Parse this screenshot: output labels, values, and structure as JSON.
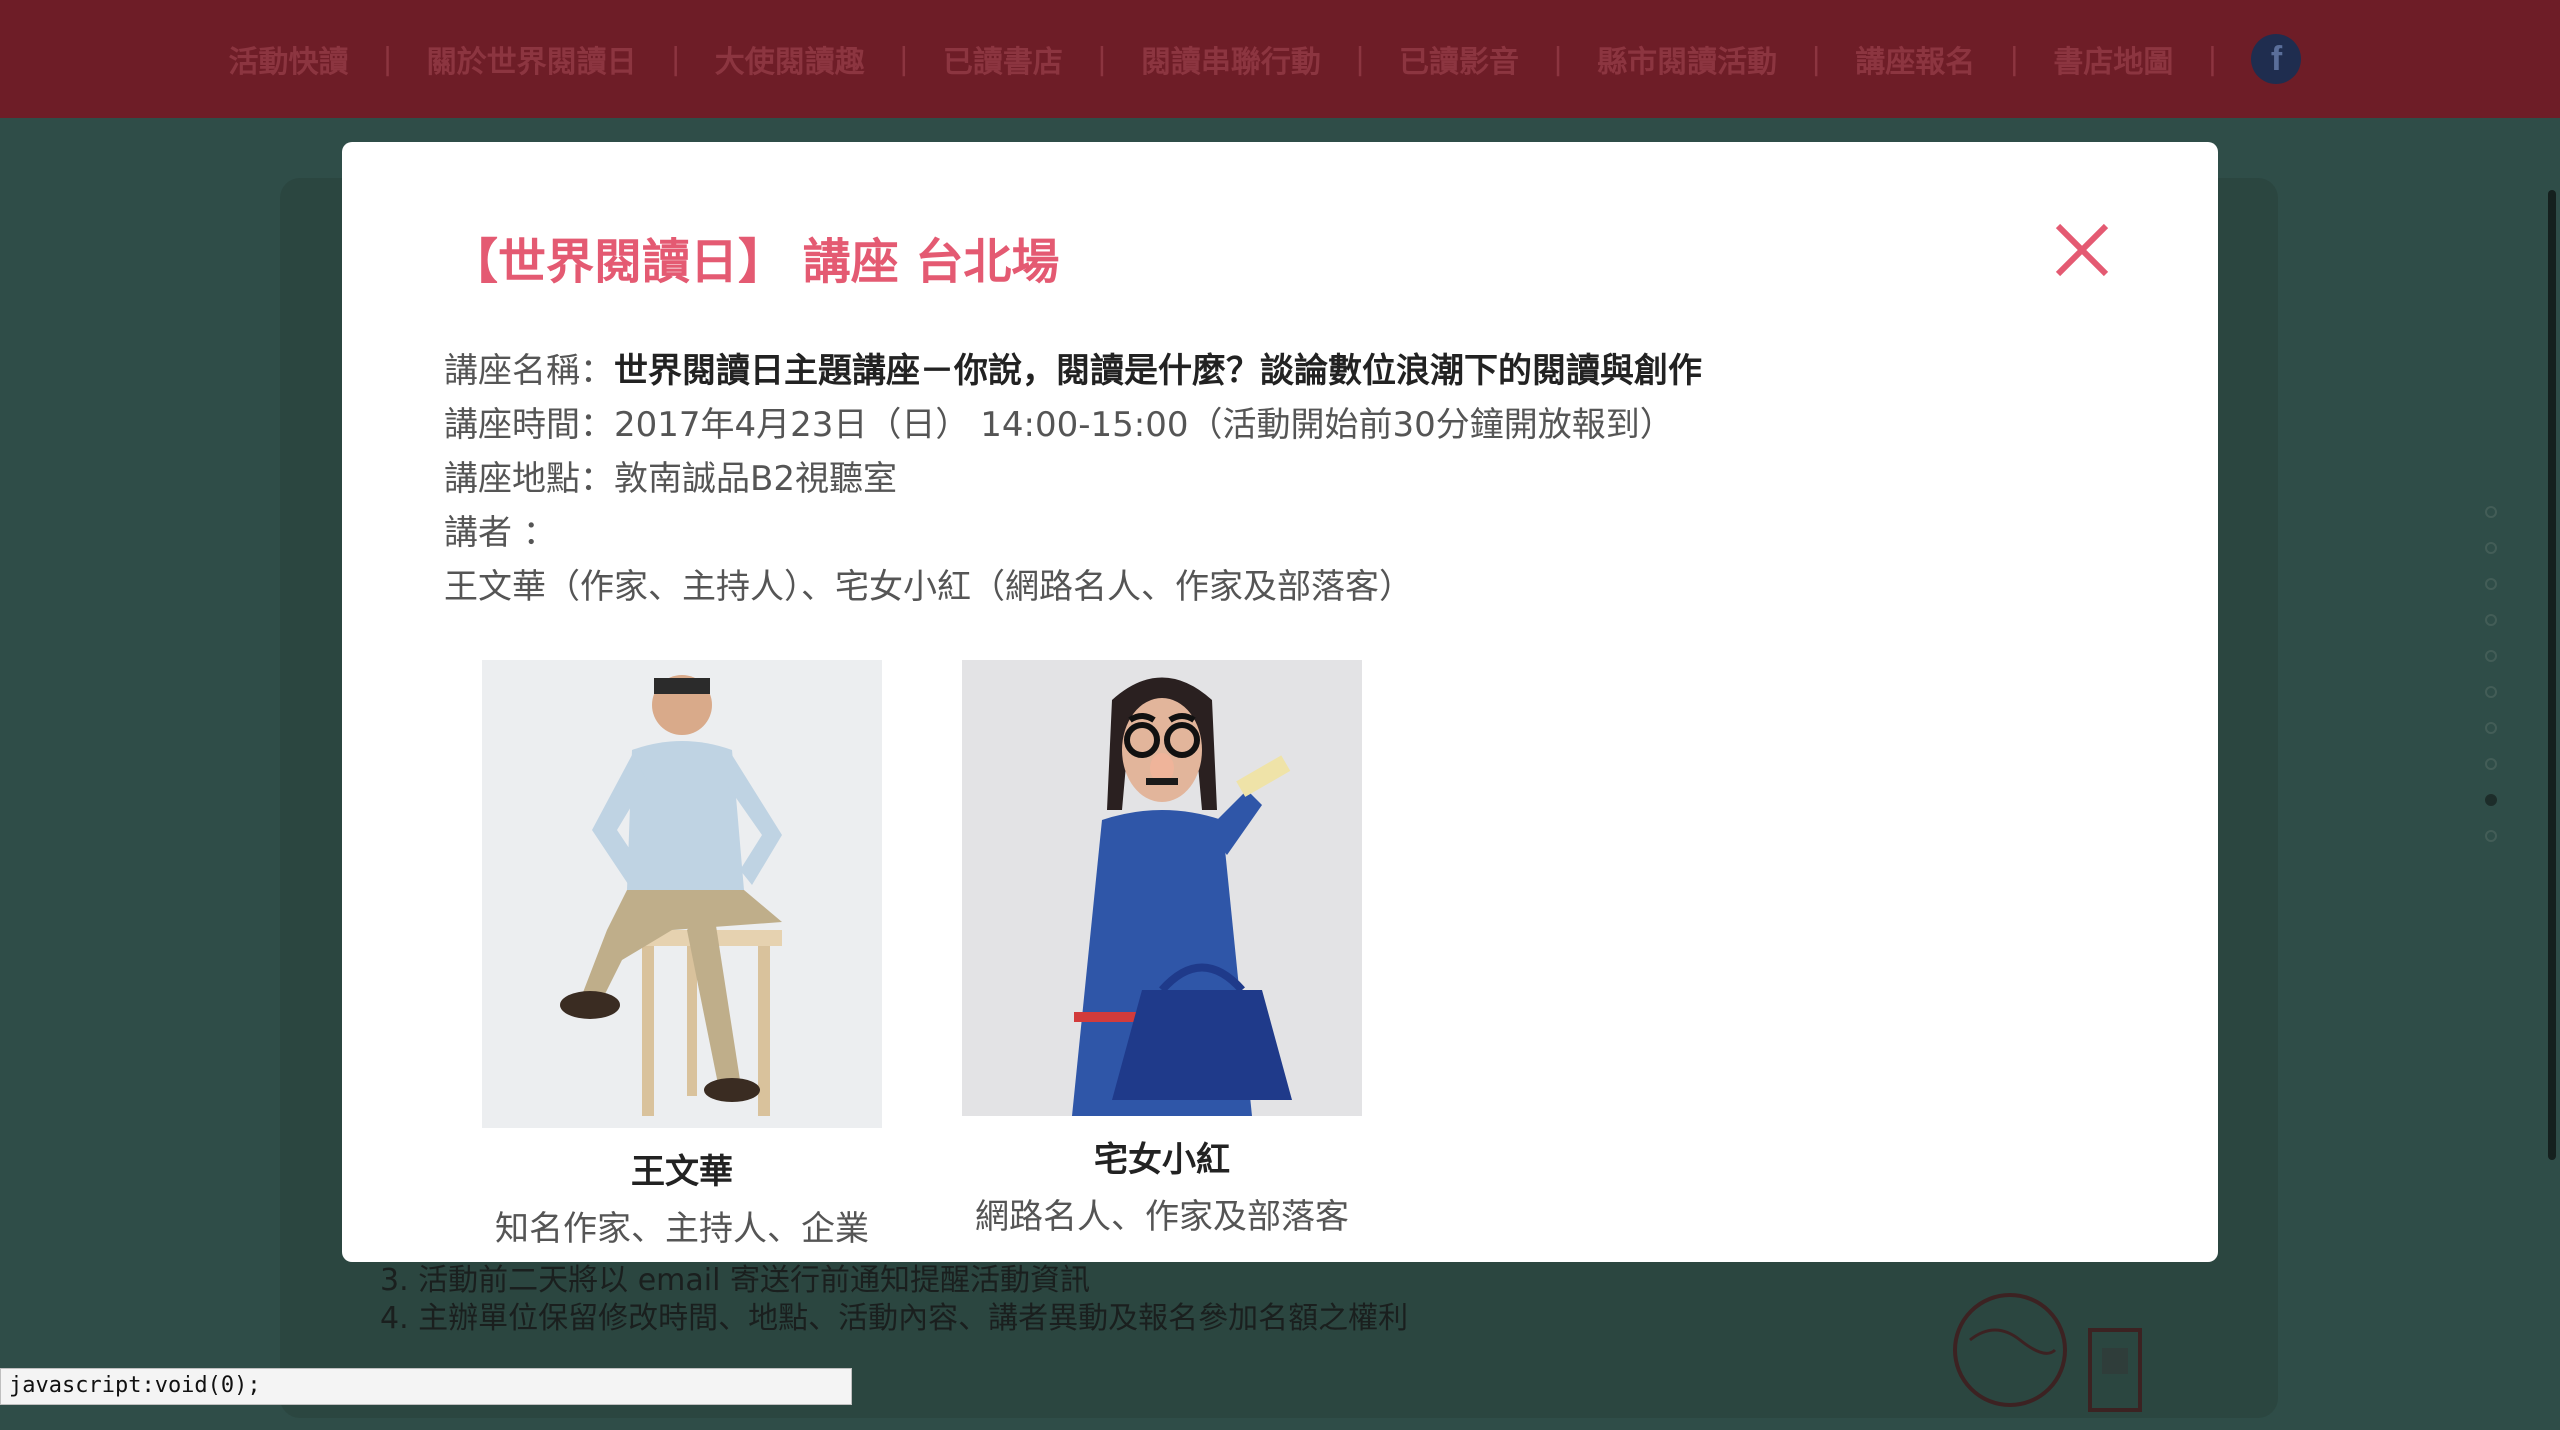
{
  "nav": {
    "items": [
      "活動快讀",
      "關於世界閱讀日",
      "大使閱讀趣",
      "已讀書店",
      "閱讀串聯行動",
      "已讀影音",
      "縣市閱讀活動",
      "講座報名",
      "書店地圖"
    ],
    "separator": "|",
    "facebook_glyph": "f",
    "facebook_icon": "facebook-icon"
  },
  "background": {
    "notes": [
      "3. 活動前二天將以 email 寄送行前通知提醒活動資訊",
      "4. 主辦單位保留修改時間、地點、活動內容、講者異動及報名參加名額之權利"
    ]
  },
  "modal": {
    "title": "【世界閱讀日】 講座 台北場",
    "close_icon": "close-icon",
    "lecture_name_label": "講座名稱：",
    "lecture_name": "世界閱讀日主題講座－你說，閱讀是什麼？談論數位浪潮下的閱讀與創作",
    "time_label": "講座時間：",
    "time": "2017年4月23日（日） 14:00-15:00（活動開始前30分鐘開放報到）",
    "location_label": "講座地點：",
    "location": "敦南誠品B2視聽室",
    "speakers_label": "講者 ：",
    "speakers_line": "王文華（作家、主持人）、宅女小紅（網路名人、作家及部落客）",
    "speakers": [
      {
        "name": "王文華",
        "role": "知名作家、主持人、企業"
      },
      {
        "name": "宅女小紅",
        "role": "網路名人、作家及部落客"
      }
    ]
  },
  "status_bar": {
    "text": "javascript:void(0);"
  },
  "colors": {
    "nav_bg": "#6e1d27",
    "page_bg": "#2f4d48",
    "accent": "#e45a72"
  }
}
